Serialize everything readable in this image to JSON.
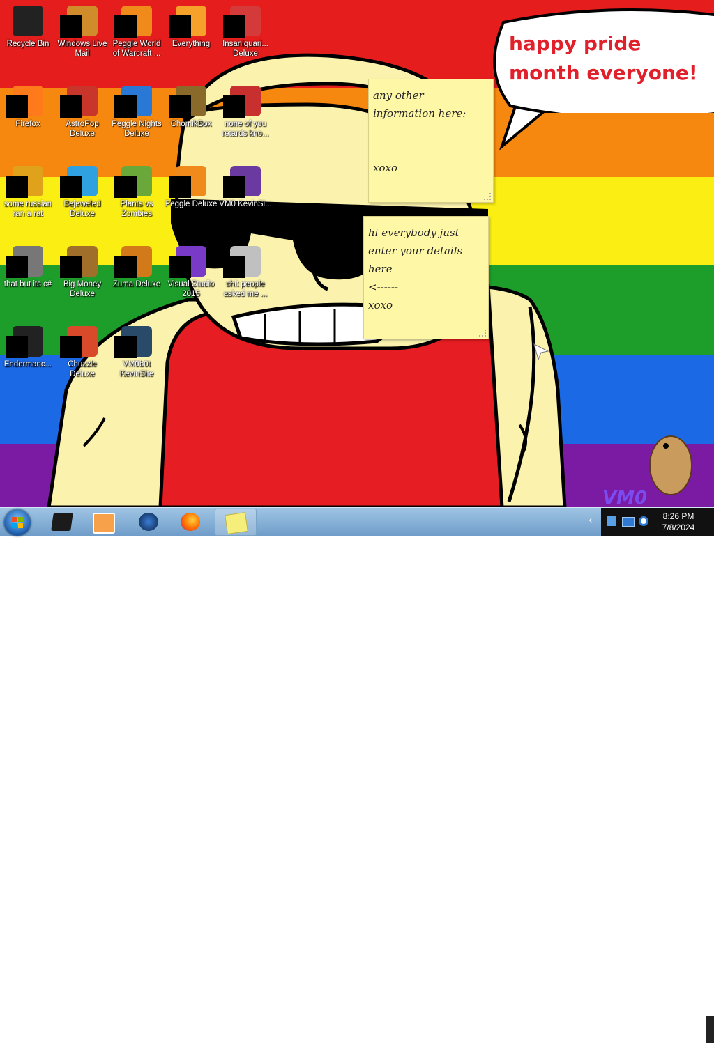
{
  "colors": {
    "stripes": [
      "#e51d1d",
      "#f7880f",
      "#fbee13",
      "#1d9d2a",
      "#1c69e6",
      "#7b1ba3"
    ],
    "skin": "#fbf3ad",
    "shirt": "#e61d22",
    "bubble_text": "#e0202a",
    "note_bg": "#fdf7a6"
  },
  "wallpaper": {
    "speech_bubble_text": "happy pride month everyone!",
    "watermark_text": "VM0"
  },
  "desktop_icons": [
    {
      "label": "Recycle Bin",
      "icon": "recycle-bin-icon"
    },
    {
      "label": "Windows Live Mail",
      "icon": "mail-icon"
    },
    {
      "label": "Peggle World of Warcraft ...",
      "icon": "peggle-icon"
    },
    {
      "label": "Everything",
      "icon": "search-icon"
    },
    {
      "label": "Insaniquari... Deluxe",
      "icon": "fish-icon"
    },
    {
      "label": "Firefox",
      "icon": "firefox-icon"
    },
    {
      "label": "AstroPop Deluxe",
      "icon": "astropop-icon"
    },
    {
      "label": "Peggle Nights Deluxe",
      "icon": "peggle-nights-icon"
    },
    {
      "label": "ChomikBox",
      "icon": "chomikbox-icon"
    },
    {
      "label": "none of you retards kno...",
      "icon": "shortcut-icon"
    },
    {
      "label": "some russian ran a rat",
      "icon": "app-icon"
    },
    {
      "label": "Bejeweled Deluxe",
      "icon": "gem-icon"
    },
    {
      "label": "Plants vs Zombies",
      "icon": "plant-icon"
    },
    {
      "label": "Peggle Deluxe",
      "icon": "peggle-deluxe-icon"
    },
    {
      "label": "VM0 KevinSi...",
      "icon": "file-icon"
    },
    {
      "label": "that but its c#",
      "icon": "files-icon"
    },
    {
      "label": "Big Money Deluxe",
      "icon": "money-bag-icon"
    },
    {
      "label": "Zuma Deluxe",
      "icon": "zuma-icon"
    },
    {
      "label": "Visual Studio 2015",
      "icon": "visual-studio-icon"
    },
    {
      "label": "shit people asked me ...",
      "icon": "folder-icon"
    },
    {
      "label": "Endermanc...",
      "icon": "terminal-icon"
    },
    {
      "label": "Chuzzle Deluxe",
      "icon": "chuzzle-icon"
    },
    {
      "label": "VM0b0t KevinSite",
      "icon": "app-icon"
    }
  ],
  "sticky_notes": [
    {
      "text": "any other\ninformation here:\n\n\nxoxo"
    },
    {
      "text": "hi everybody just\nenter your details\nhere\n<------\nxoxo"
    }
  ],
  "taskbar": {
    "items": [
      {
        "name": "explorer-icon"
      },
      {
        "name": "media-player-icon"
      },
      {
        "name": "globe-icon"
      },
      {
        "name": "firefox-icon"
      },
      {
        "name": "sticky-notes-icon"
      }
    ],
    "tray_overflow": "‹",
    "clock_time": "8:26 PM",
    "clock_date": "7/8/2024"
  }
}
